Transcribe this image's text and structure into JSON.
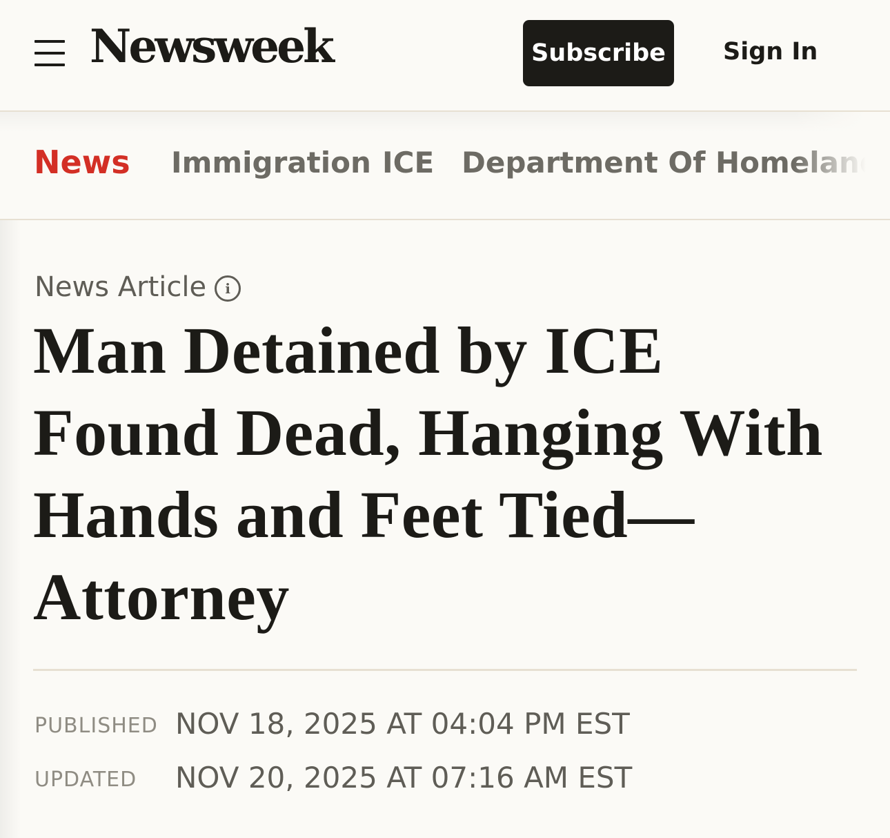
{
  "header": {
    "logo": "Newsweek",
    "subscribe_label": "Subscribe",
    "signin_label": "Sign In"
  },
  "nav": {
    "items": [
      {
        "label": "News",
        "active": true
      },
      {
        "label": "Immigration",
        "active": false
      },
      {
        "label": "ICE",
        "active": false
      },
      {
        "label": "Department Of Homeland Security",
        "active": false
      }
    ]
  },
  "article": {
    "type_label": "News Article",
    "info_icon": "info-icon",
    "headline_lines": [
      "Man Detained by ICE",
      "Found Dead, Hanging With",
      "Hands and Feet Tied—",
      "Attorney"
    ],
    "published_label": "PUBLISHED",
    "published_value": "NOV 18, 2025 AT 04:04 PM EST",
    "updated_label": "UPDATED",
    "updated_value": "NOV 20, 2025 AT 07:16 AM EST"
  },
  "colors": {
    "background": "#fbfaf6",
    "text": "#1c1b17",
    "accent_red": "#d32f25",
    "muted": "#6d6b64",
    "divider": "#e7e0d2"
  }
}
